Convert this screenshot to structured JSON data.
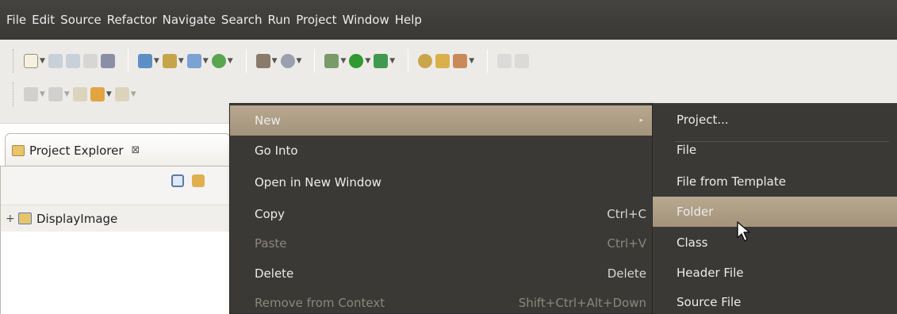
{
  "menubar": {
    "items": [
      "File",
      "Edit",
      "Source",
      "Refactor",
      "Navigate",
      "Search",
      "Run",
      "Project",
      "Window",
      "Help"
    ]
  },
  "toolbar": {
    "row1_icons": [
      "new-wizard-icon",
      "save-icon",
      "save-all-icon",
      "print-icon",
      "build-icon",
      "new-c-project-icon",
      "new-class-icon",
      "new-source-folder-icon",
      "new-header-icon",
      "build-hammer-icon",
      "debug-history-icon",
      "debug-icon",
      "run-icon",
      "external-tools-icon",
      "open-type-icon",
      "open-element-icon",
      "search-icon",
      "toggle-annotation-icon",
      "next-annotation-icon"
    ],
    "row2_icons": [
      "next-edit-icon",
      "prev-edit-icon",
      "back-icon",
      "forward-icon"
    ]
  },
  "project_explorer": {
    "tab_label": "Project Explorer",
    "close_glyph": "⊠",
    "project_name": "DisplayImage",
    "expand_glyph": "+"
  },
  "context_menu": {
    "items": [
      {
        "label": "New",
        "shortcut": "",
        "submenu": true,
        "selected": true,
        "enabled": true
      },
      {
        "label": "Go Into",
        "shortcut": "",
        "enabled": true
      },
      {
        "label": "Open in New Window",
        "shortcut": "",
        "enabled": true
      },
      {
        "label": "Copy",
        "shortcut": "Ctrl+C",
        "enabled": true
      },
      {
        "label": "Paste",
        "shortcut": "Ctrl+V",
        "enabled": false
      },
      {
        "label": "Delete",
        "shortcut": "Delete",
        "enabled": true
      },
      {
        "label": "Remove from Context",
        "shortcut": "Shift+Ctrl+Alt+Down",
        "enabled": false
      }
    ],
    "submenu_arrow": "▸"
  },
  "new_submenu": {
    "items": [
      "Project...",
      "File",
      "File from Template",
      "Folder",
      "Class",
      "Header File",
      "Source File"
    ],
    "selected_index": 3
  },
  "colors": {
    "menu_bg": "#3b3936",
    "selection": "#a99a82",
    "menu_text": "#ececec",
    "disabled_text": "#8a8782"
  }
}
